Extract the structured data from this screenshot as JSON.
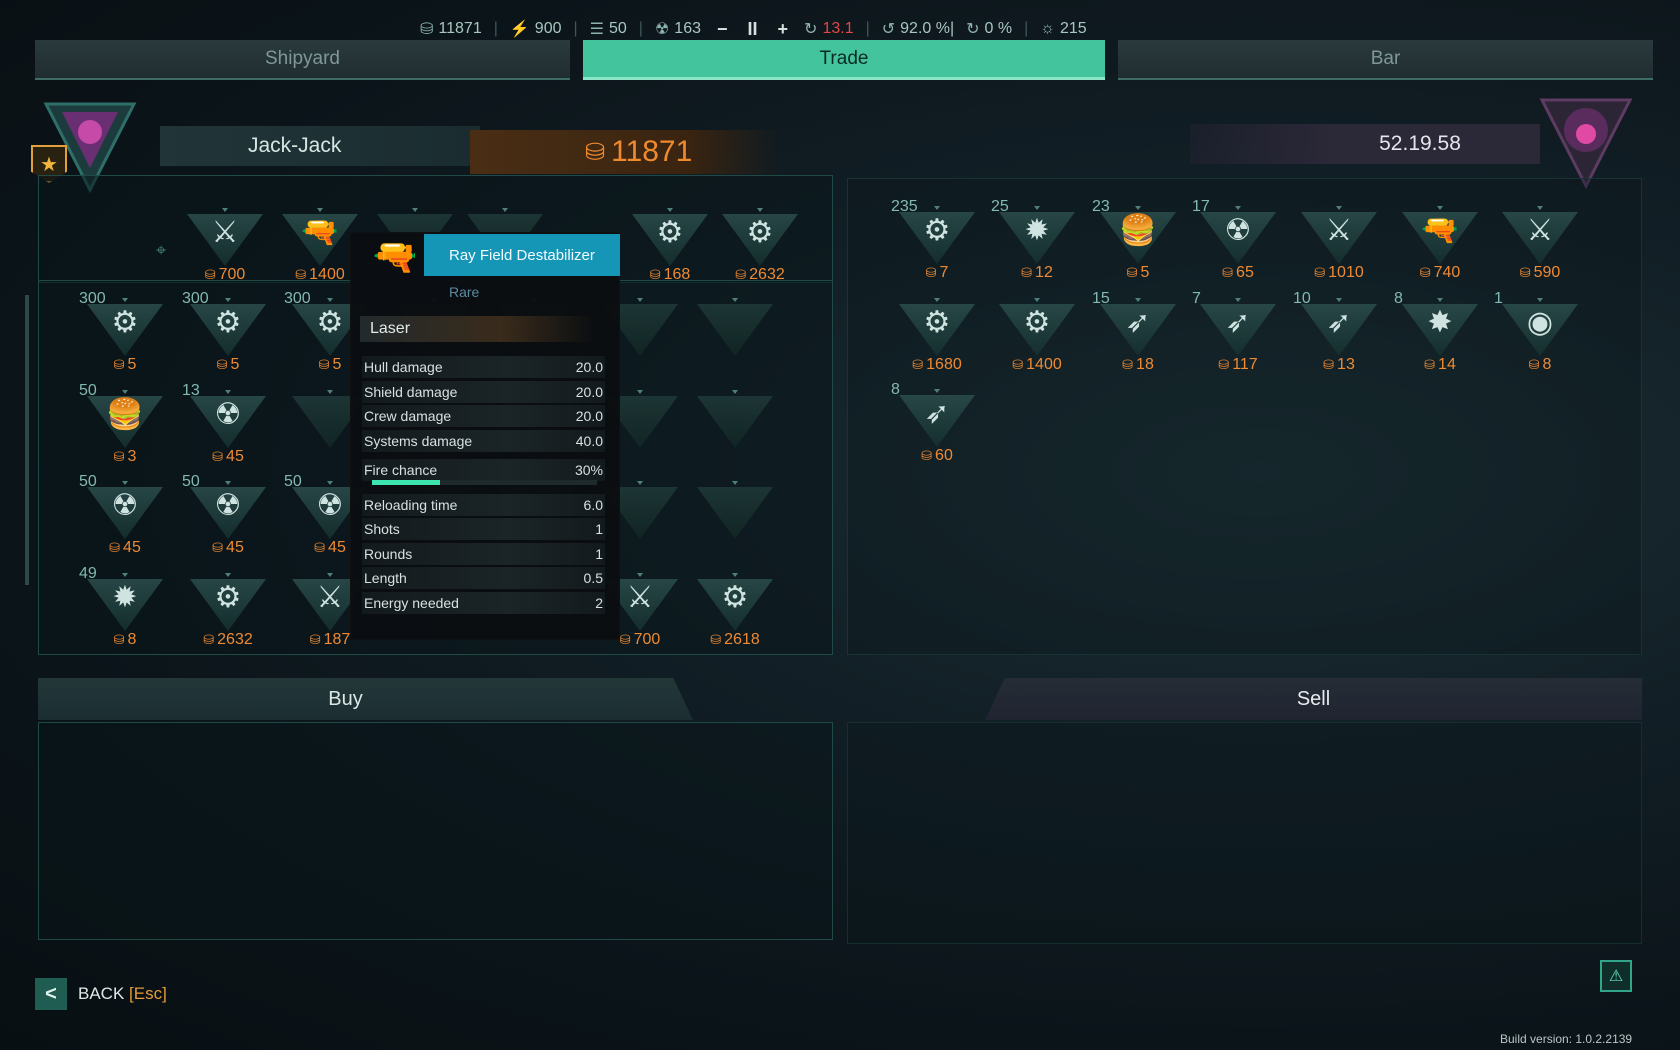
{
  "topbar": {
    "credits": "11871",
    "fuel": "900",
    "food": "50",
    "radiation": "163",
    "minus": "−",
    "pause": "II",
    "plus": "+",
    "danger": "13.1",
    "hull": "92.0 %|",
    "repair": "0 %",
    "crew": "215"
  },
  "tabs": {
    "shipyard": "Shipyard",
    "trade": "Trade",
    "bar": "Bar"
  },
  "player": {
    "name": "Jack-Jack",
    "money": "11871"
  },
  "trader": {
    "name": "52.19.58"
  },
  "tooltip": {
    "title": "Ray Field Destabilizer",
    "rarity": "Rare",
    "type": "Laser",
    "stats": [
      {
        "label": "Hull damage",
        "value": "20.0"
      },
      {
        "label": "Shield damage",
        "value": "20.0"
      },
      {
        "label": "Crew damage",
        "value": "20.0"
      },
      {
        "label": "Systems damage",
        "value": "40.0"
      },
      {
        "label": "Fire chance",
        "value": "30%"
      },
      {
        "label": "Reloading time",
        "value": "6.0"
      },
      {
        "label": "Shots",
        "value": "1"
      },
      {
        "label": "Rounds",
        "value": "1"
      },
      {
        "label": "Length",
        "value": "0.5"
      },
      {
        "label": "Energy needed",
        "value": "2"
      }
    ],
    "fire_chance_fraction": 0.3
  },
  "left_top_items": [
    {
      "icon": "weapon-icon",
      "glyph": "⚔",
      "qty": "",
      "price": "700"
    },
    {
      "icon": "laser-cannon-icon",
      "glyph": "🔫",
      "qty": "",
      "price": "1400"
    },
    {
      "icon": "cannon-icon",
      "glyph": "⚙",
      "qty": "",
      "price": "168"
    },
    {
      "icon": "turret-icon",
      "glyph": "⚙",
      "qty": "",
      "price": "2632"
    }
  ],
  "left_rows": [
    [
      {
        "icon": "gear-module-icon",
        "glyph": "⚙",
        "qty": "300",
        "price": "5"
      },
      {
        "icon": "gear-module-icon",
        "glyph": "⚙",
        "qty": "300",
        "price": "5"
      },
      {
        "icon": "gear-module-icon",
        "glyph": "⚙",
        "qty": "300",
        "price": "5"
      }
    ],
    [
      {
        "icon": "burger-icon",
        "glyph": "🍔",
        "qty": "50",
        "price": "3"
      },
      {
        "icon": "radiation-canister-icon",
        "glyph": "☢",
        "qty": "13",
        "price": "45"
      }
    ],
    [
      {
        "icon": "radiation-canister-icon",
        "glyph": "☢",
        "qty": "50",
        "price": "45"
      },
      {
        "icon": "radiation-canister-icon",
        "glyph": "☢",
        "qty": "50",
        "price": "45"
      },
      {
        "icon": "radiation-canister-icon",
        "glyph": "☢",
        "qty": "50",
        "price": "45"
      }
    ],
    [
      {
        "icon": "red-drone-icon",
        "glyph": "✹",
        "qty": "49",
        "price": "8"
      },
      {
        "icon": "turret-icon",
        "glyph": "⚙",
        "qty": "",
        "price": "2632"
      },
      {
        "icon": "gun-icon",
        "glyph": "⚔",
        "qty": "",
        "price": "187"
      }
    ]
  ],
  "left_bottom_extra": [
    {
      "icon": "weapon-icon",
      "glyph": "⚔",
      "qty": "",
      "price": "700"
    },
    {
      "icon": "heavy-turret-icon",
      "glyph": "⚙",
      "qty": "",
      "price": "2618"
    }
  ],
  "right_row1": [
    {
      "icon": "gear-module-icon",
      "glyph": "⚙",
      "qty": "235",
      "price": "7"
    },
    {
      "icon": "red-drone-icon",
      "glyph": "✹",
      "qty": "25",
      "price": "12"
    },
    {
      "icon": "burger-icon",
      "glyph": "🍔",
      "qty": "23",
      "price": "5"
    },
    {
      "icon": "radiation-canister-icon",
      "glyph": "☢",
      "qty": "17",
      "price": "65"
    },
    {
      "icon": "rifle-icon",
      "glyph": "⚔",
      "qty": "",
      "price": "1010"
    },
    {
      "icon": "laser-cannon-icon",
      "glyph": "🔫",
      "qty": "",
      "price": "740"
    },
    {
      "icon": "cannon-icon",
      "glyph": "⚔",
      "qty": "",
      "price": "590"
    }
  ],
  "right_row2": [
    {
      "icon": "heavy-cannon-icon",
      "glyph": "⚙",
      "qty": "",
      "price": "1680"
    },
    {
      "icon": "missile-launcher-icon",
      "glyph": "⚙",
      "qty": "",
      "price": "1400"
    },
    {
      "icon": "missile-icon",
      "glyph": "➶",
      "qty": "15",
      "price": "18"
    },
    {
      "icon": "torpedo-icon",
      "glyph": "➶",
      "qty": "7",
      "price": "117"
    },
    {
      "icon": "missile-icon",
      "glyph": "➶",
      "qty": "10",
      "price": "13"
    },
    {
      "icon": "mine-icon",
      "glyph": "✸",
      "qty": "8",
      "price": "14"
    },
    {
      "icon": "orb-drone-icon",
      "glyph": "◉",
      "qty": "1",
      "price": "8"
    }
  ],
  "right_row3": [
    {
      "icon": "missile-icon",
      "glyph": "➶",
      "qty": "8",
      "price": "60"
    }
  ],
  "buy_label": "Buy",
  "sell_label": "Sell",
  "back": {
    "label": "BACK",
    "key": "[Esc]"
  },
  "build_version": "Build version: 1.0.2.2139",
  "colors": {
    "accent": "#43c49d",
    "price": "#ef8a33",
    "rare": "#1596b7",
    "danger": "#e24646"
  }
}
